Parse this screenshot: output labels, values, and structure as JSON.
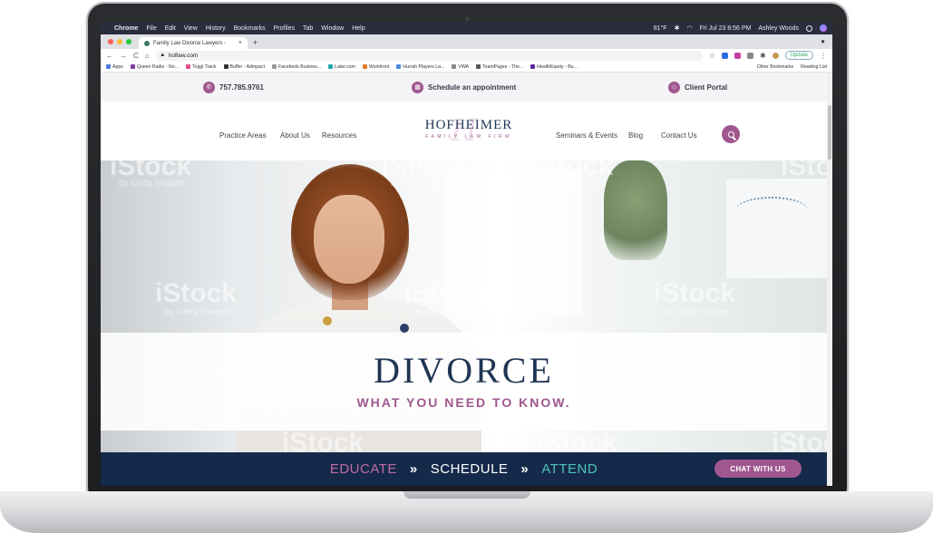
{
  "menubar": {
    "app": "Chrome",
    "items": [
      "File",
      "Edit",
      "View",
      "History",
      "Bookmarks",
      "Profiles",
      "Tab",
      "Window",
      "Help"
    ],
    "weather": "81°F",
    "clock": "Fri Jul 23  8:56 PM",
    "user": "Ashley Woods"
  },
  "browser": {
    "tab_title": "Family Law Divorce Lawyers - ",
    "url": "hoflaw.com",
    "update_label": "Update",
    "bookmarks": [
      "Apps",
      "Queen Radio - No...",
      "Toggl Track",
      "Buffer - Admpact",
      "Facebook Busines...",
      "Later.com",
      "Workfront",
      "Hurrah Players La...",
      "VWA",
      "TeamPages - The...",
      "HealthEquity - Bu..."
    ],
    "bookmarks_right": [
      "Other Bookmarks",
      "Reading List"
    ]
  },
  "site": {
    "topbar": {
      "phone": "757.785.9761",
      "schedule": "Schedule an appointment",
      "portal": "Client Portal"
    },
    "nav": {
      "practice": "Practice Areas",
      "about": "About Us",
      "resources": "Resources",
      "seminars": "Seminars & Events",
      "blog": "Blog",
      "contact": "Contact Us"
    },
    "logo": {
      "main": "HOFHEIMER",
      "sub": "FAMILY LAW FIRM"
    },
    "hero": {
      "title": "DIVORCE",
      "subtitle": "WHAT YOU NEED TO KNOW.",
      "watermark": "iStock",
      "watermark_sub": "by Getty Images"
    },
    "cta": {
      "educate": "EDUCATE",
      "sep": "»",
      "schedule": "SCHEDULE",
      "attend": "ATTEND",
      "chat": "CHAT WITH US"
    }
  },
  "colors": {
    "navy": "#1f3553",
    "plum": "#a0578f",
    "teal": "#4fc3c0",
    "footer": "#15294a"
  }
}
